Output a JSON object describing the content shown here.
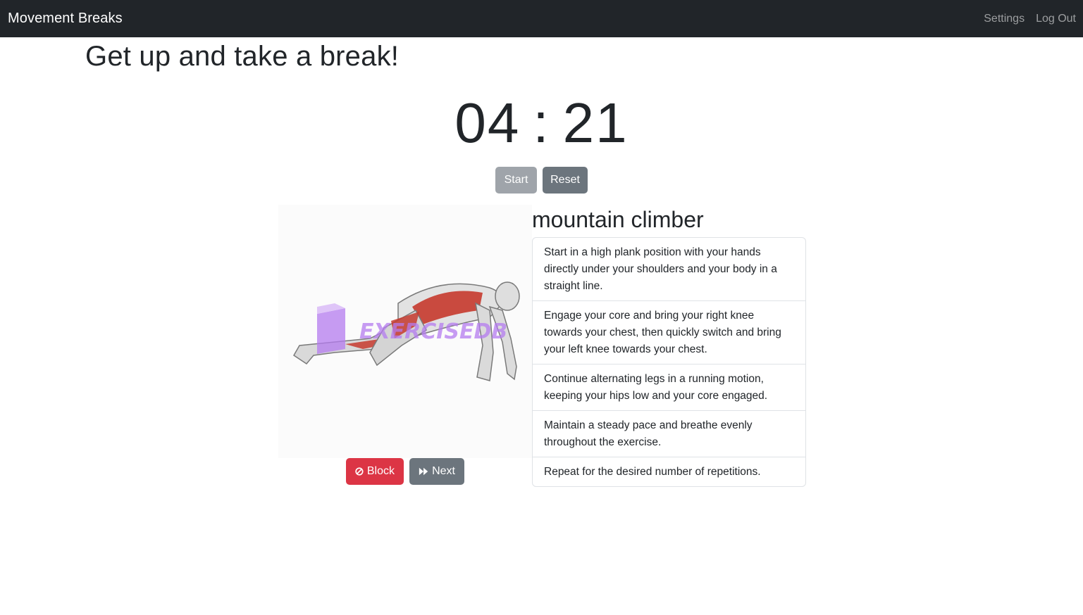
{
  "navbar": {
    "brand": "Movement Breaks",
    "links": [
      "Settings",
      "Log Out"
    ]
  },
  "page": {
    "heading": "Get up and take a break!"
  },
  "timer": {
    "minutes": "04",
    "separator": ":",
    "seconds": "21",
    "start_label": "Start",
    "reset_label": "Reset"
  },
  "exercise": {
    "name": "mountain climber",
    "image_watermark": "EXERCISEDB",
    "block_label": "Block",
    "next_label": "Next",
    "instructions": [
      "Start in a high plank position with your hands directly under your shoulders and your body in a straight line.",
      "Engage your core and bring your right knee towards your chest, then quickly switch and bring your left knee towards your chest.",
      "Continue alternating legs in a running motion, keeping your hips low and your core engaged.",
      "Maintain a steady pace and breathe evenly throughout the exercise.",
      "Repeat for the desired number of repetitions."
    ]
  },
  "colors": {
    "navbar_bg": "#212529",
    "danger": "#dc3545",
    "secondary": "#6c757d",
    "watermark": "#b57cf0",
    "muscle_highlight": "#c63a2e"
  },
  "icons": {
    "block": "ban-icon",
    "next": "fast-forward-icon"
  }
}
